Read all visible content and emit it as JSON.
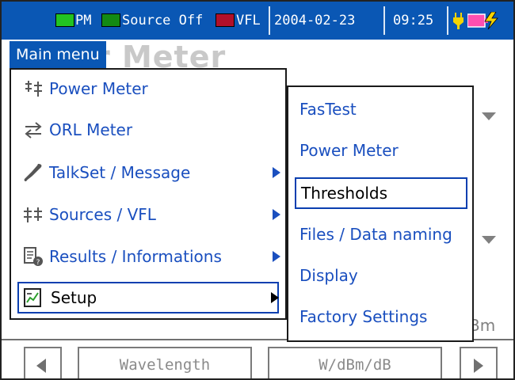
{
  "status_bar": {
    "pm_label": "PM",
    "source_label": "Source Off",
    "vfl_label": "VFL",
    "date": "2004-02-23",
    "time": "09:25",
    "colors": {
      "bar": "#0a57b4",
      "pm": "#22c322",
      "source": "#138a13",
      "vfl": "#b0102a",
      "plug": "#f5d400",
      "battery": "#ff4fb0"
    }
  },
  "background": {
    "title_fragment": "r Meter",
    "unit_fragment": "Bm"
  },
  "main_menu": {
    "title": "Main menu",
    "items": [
      {
        "label": "Power Meter",
        "icon": "power-meter-icon",
        "has_submenu": false
      },
      {
        "label": "ORL Meter",
        "icon": "orl-arrows-icon",
        "has_submenu": false
      },
      {
        "label": "TalkSet / Message",
        "icon": "phone-handset-icon",
        "has_submenu": true
      },
      {
        "label": "Sources / VFL",
        "icon": "sources-icon",
        "has_submenu": true
      },
      {
        "label": "Results / Informations",
        "icon": "document-info-icon",
        "has_submenu": true
      },
      {
        "label": "Setup",
        "icon": "setup-chart-icon",
        "has_submenu": true,
        "selected": true
      }
    ]
  },
  "setup_submenu": {
    "items": [
      {
        "label": "FasTest"
      },
      {
        "label": "Power Meter"
      },
      {
        "label": "Thresholds",
        "selected": true
      },
      {
        "label": "Files / Data naming"
      },
      {
        "label": "Display"
      },
      {
        "label": "Factory Settings"
      }
    ]
  },
  "softkeys": {
    "wavelength": "Wavelength",
    "units": "W/dBm/dB"
  }
}
